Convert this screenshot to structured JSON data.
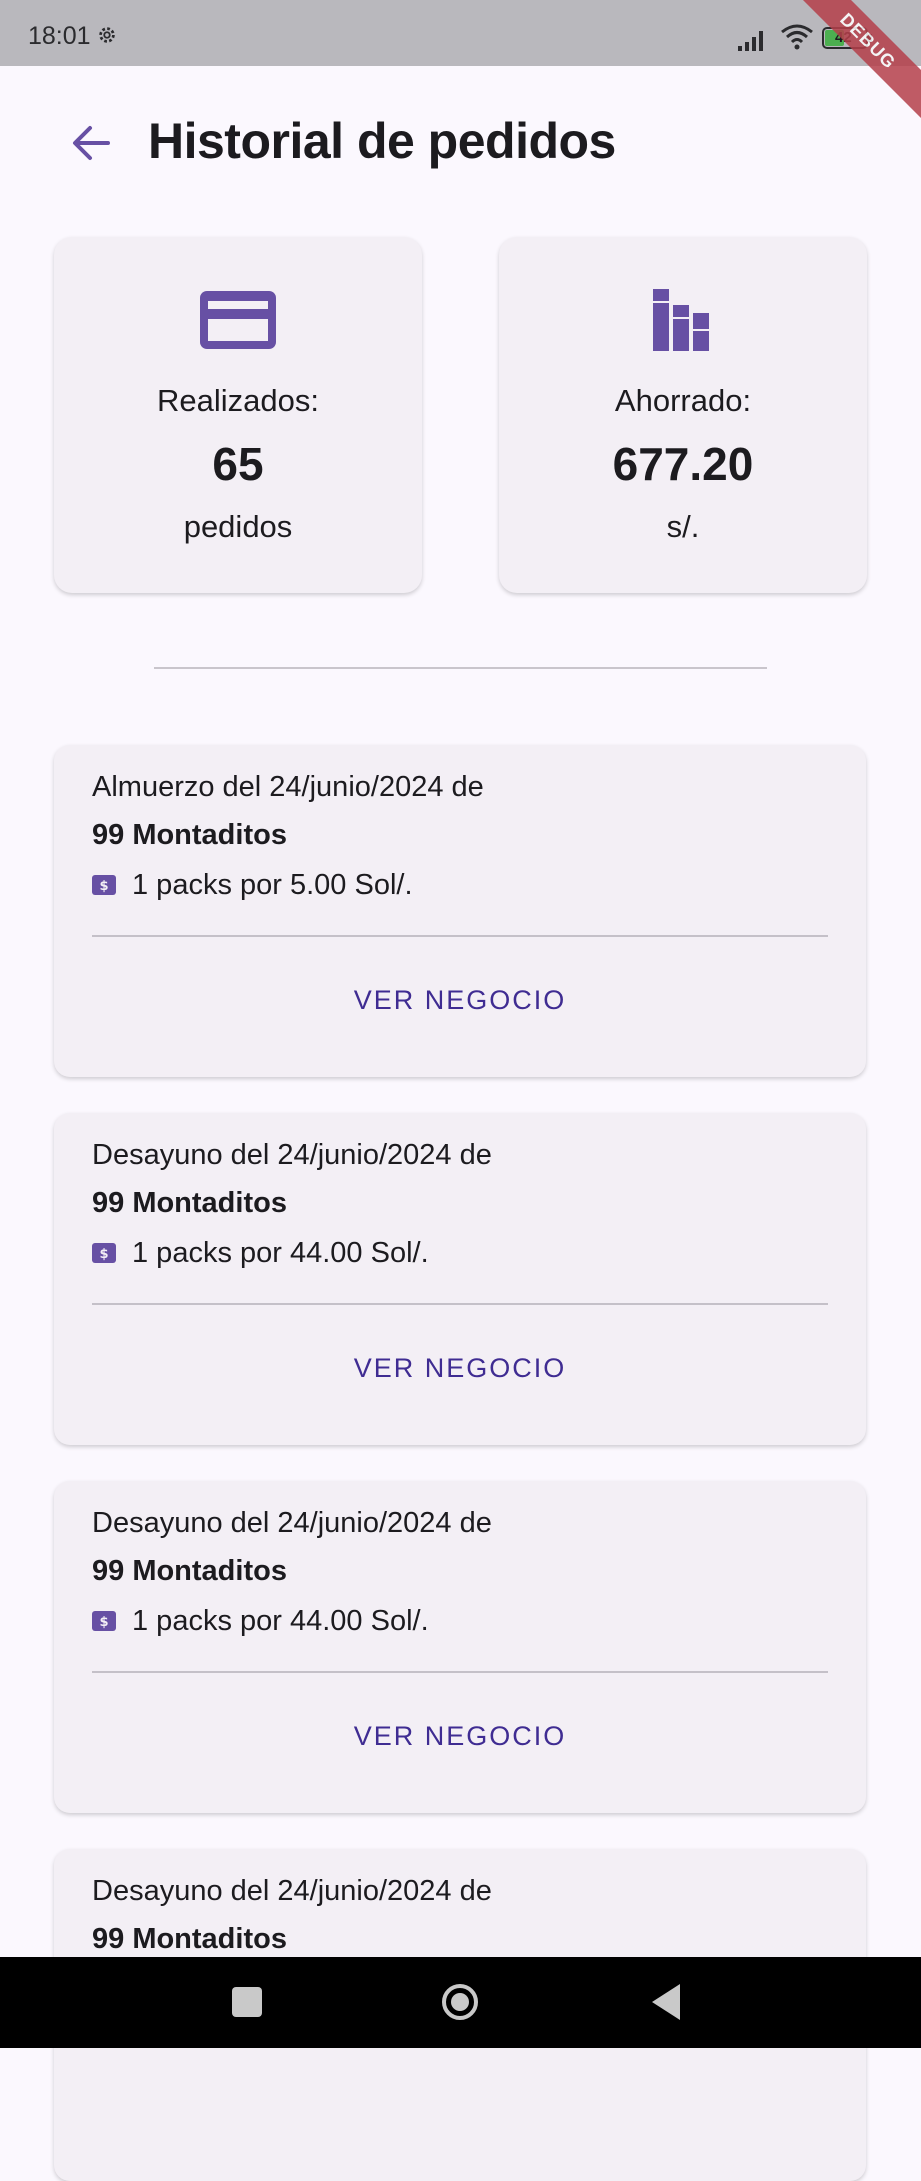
{
  "status_bar": {
    "time": "18:01",
    "battery": "42",
    "debug_label": "DEBUG"
  },
  "app_bar": {
    "title": "Historial de pedidos"
  },
  "stats": {
    "orders": {
      "icon": "credit-card-icon",
      "label": "Realizados:",
      "value": "65",
      "unit": "pedidos"
    },
    "savings": {
      "icon": "bar-chart-icon",
      "label": "Ahorrado:",
      "value": "677.20",
      "unit": "s/."
    }
  },
  "orders": [
    {
      "title": "Almuerzo del 24/junio/2024 de",
      "business": "99 Montaditos",
      "pack": "1 packs por 5.00 Sol/.",
      "button": "VER NEGOCIO"
    },
    {
      "title": "Desayuno del 24/junio/2024 de",
      "business": "99 Montaditos",
      "pack": "1 packs por 44.00 Sol/.",
      "button": "VER NEGOCIO"
    },
    {
      "title": "Desayuno del 24/junio/2024 de",
      "business": "99 Montaditos",
      "pack": "1 packs por 44.00 Sol/.",
      "button": "VER NEGOCIO"
    },
    {
      "title": "Desayuno del 24/junio/2024 de",
      "business": "99 Montaditos"
    }
  ],
  "colors": {
    "accent": "#6750a4",
    "button_text": "#3f2c92",
    "card_bg": "#f3eff5",
    "page_bg": "#fbf8fe"
  }
}
